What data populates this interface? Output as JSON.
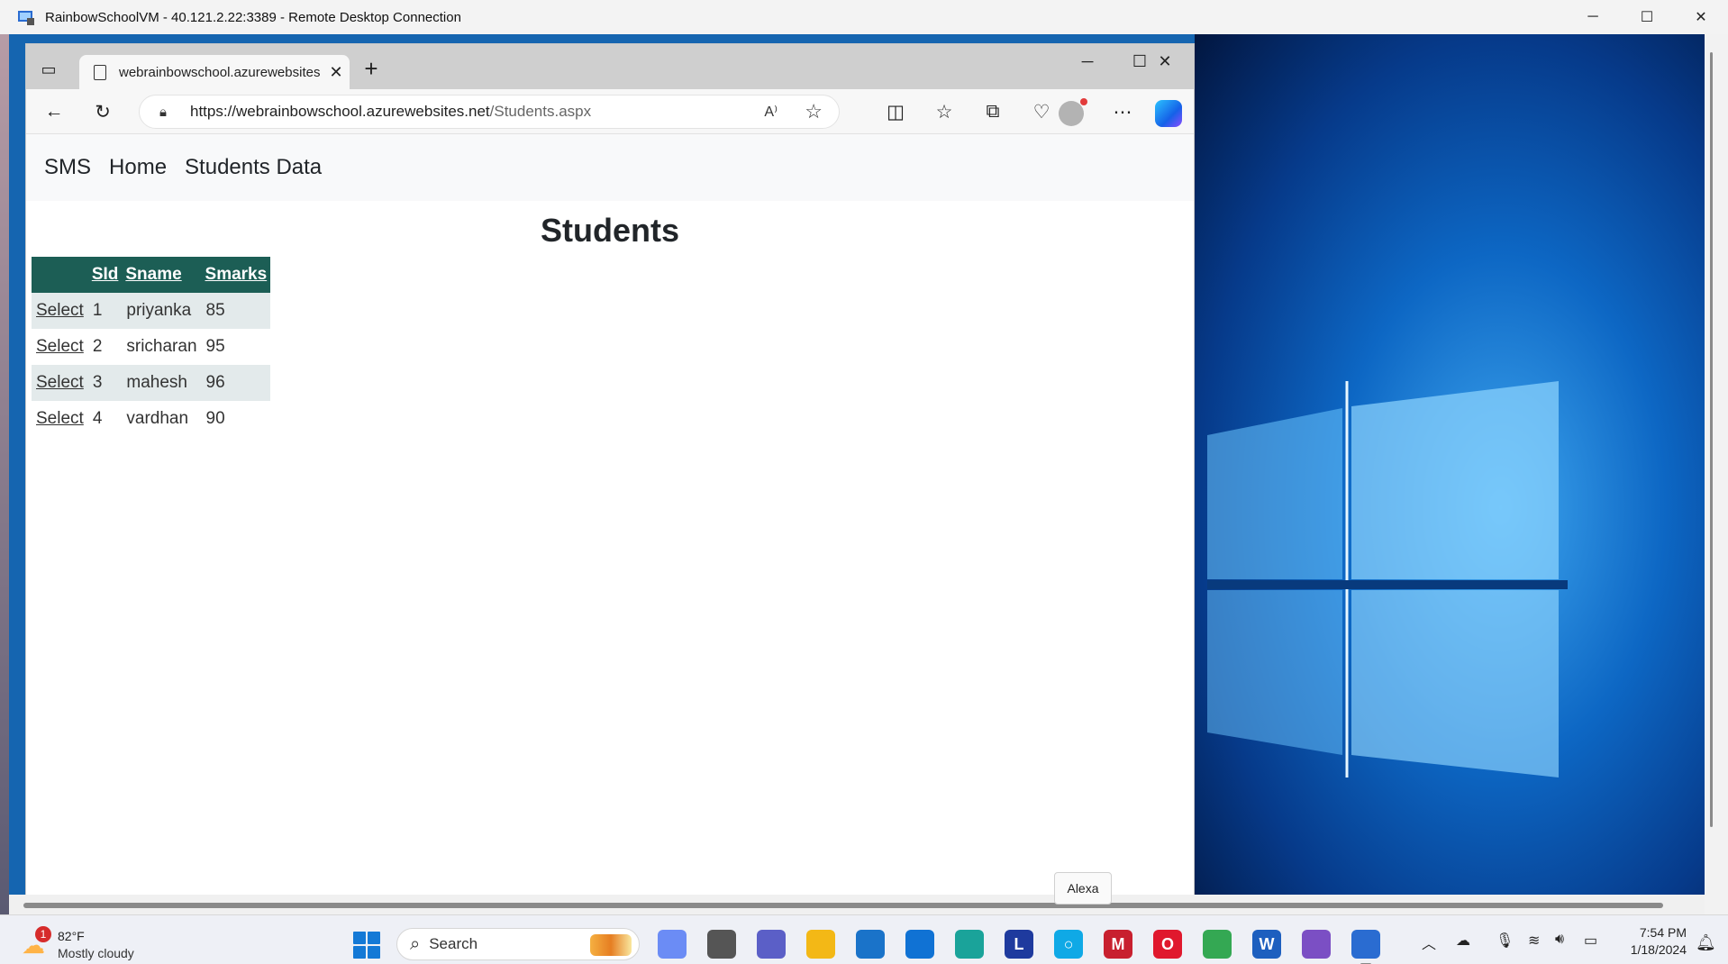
{
  "rdp": {
    "title": "RainbowSchoolVM - 40.121.2.22:3389 - Remote Desktop Connection",
    "minimize": "─",
    "maximize": "☐",
    "close": "✕"
  },
  "browser": {
    "tab_title": "webrainbowschool.azurewebsites",
    "tab_close": "✕",
    "new_tab": "+",
    "url_host": "https://webrainbowschool.azurewebsites.net",
    "url_path": "/Students.aspx",
    "window_controls": {
      "minimize": "─",
      "maximize": "☐",
      "close": "✕"
    }
  },
  "site": {
    "brand": "SMS",
    "nav": [
      "Home",
      "Students Data"
    ],
    "heading": "Students"
  },
  "table": {
    "headers": [
      "SId",
      "Sname",
      "Smarks"
    ],
    "select_label": "Select",
    "rows": [
      {
        "sid": "1",
        "sname": "priyanka",
        "smarks": "85"
      },
      {
        "sid": "2",
        "sname": "sricharan",
        "smarks": "95"
      },
      {
        "sid": "3",
        "sname": "mahesh",
        "smarks": "96"
      },
      {
        "sid": "4",
        "sname": "vardhan",
        "smarks": "90"
      }
    ]
  },
  "tooltip": "Alexa",
  "taskbar": {
    "weather_badge": "1",
    "temperature": "82°F",
    "condition": "Mostly cloudy",
    "search_label": "Search",
    "time": "7:54 PM",
    "date": "1/18/2024",
    "apps": [
      {
        "name": "copilot-app",
        "color": "#6b8cf5",
        "glyph": ""
      },
      {
        "name": "file-manager-app",
        "color": "#555555",
        "glyph": ""
      },
      {
        "name": "teams-app",
        "color": "#5b5fc7",
        "glyph": ""
      },
      {
        "name": "file-explorer-app",
        "color": "#f3b816",
        "glyph": ""
      },
      {
        "name": "store-app",
        "color": "#1a73c9",
        "glyph": ""
      },
      {
        "name": "mail-app",
        "color": "#1072d4",
        "glyph": ""
      },
      {
        "name": "edge-app",
        "color": "#1aa39a",
        "glyph": ""
      },
      {
        "name": "l-app",
        "color": "#1e3a9e",
        "glyph": "L"
      },
      {
        "name": "alexa-app",
        "color": "#0fa9e6",
        "glyph": "○"
      },
      {
        "name": "mcafee-app",
        "color": "#c8202f",
        "glyph": "M"
      },
      {
        "name": "opera-app",
        "color": "#e0182d",
        "glyph": "O"
      },
      {
        "name": "chrome-app",
        "color": "#34a853",
        "glyph": ""
      },
      {
        "name": "word-app",
        "color": "#1d5fbf",
        "glyph": "W"
      },
      {
        "name": "visual-studio-app",
        "color": "#7b4fc4",
        "glyph": ""
      },
      {
        "name": "remote-desktop-app",
        "color": "#2a6cd1",
        "glyph": ""
      }
    ]
  }
}
